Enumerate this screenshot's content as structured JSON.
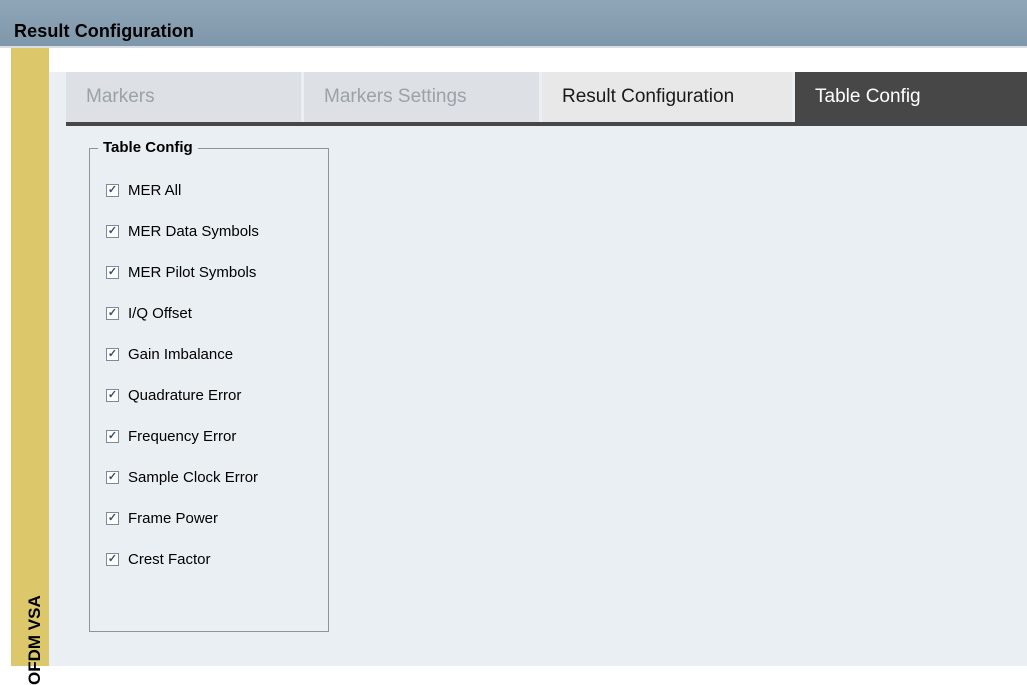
{
  "window": {
    "title": "Result Configuration"
  },
  "side_panel": {
    "label": "OFDM VSA"
  },
  "tabs": [
    {
      "label": "Markers",
      "state": "disabled"
    },
    {
      "label": "Markers Settings",
      "state": "disabled"
    },
    {
      "label": "Result Configuration",
      "state": "normal"
    },
    {
      "label": "Table Config",
      "state": "active"
    }
  ],
  "group": {
    "title": "Table Config",
    "items": [
      {
        "label": "MER All",
        "checked": true
      },
      {
        "label": "MER Data Symbols",
        "checked": true
      },
      {
        "label": "MER Pilot Symbols",
        "checked": true
      },
      {
        "label": "I/Q Offset",
        "checked": true
      },
      {
        "label": "Gain Imbalance",
        "checked": true
      },
      {
        "label": "Quadrature Error",
        "checked": true
      },
      {
        "label": "Frequency Error",
        "checked": true
      },
      {
        "label": "Sample Clock Error",
        "checked": true
      },
      {
        "label": "Frame Power",
        "checked": true
      },
      {
        "label": "Crest Factor",
        "checked": true
      }
    ]
  },
  "colors": {
    "titlebar": "#8fa6b8",
    "side_strip": "#dcc86a",
    "active_tab": "#474747",
    "content_bg": "#eaeff4"
  }
}
